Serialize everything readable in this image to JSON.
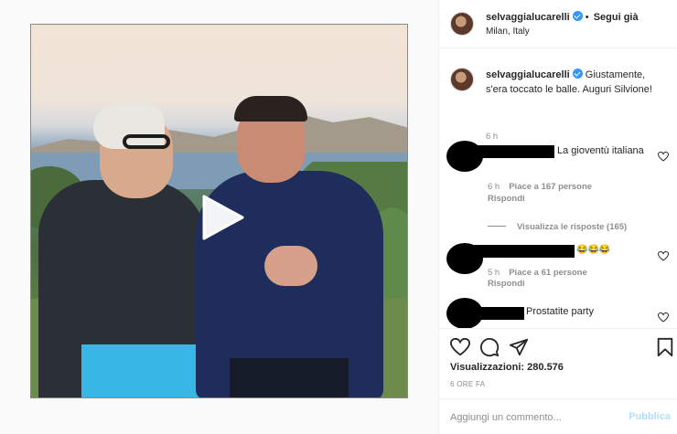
{
  "post": {
    "username": "selvaggialucarelli",
    "follow_separator": "•",
    "follow_label": "Segui già",
    "location": "Milan, Italy",
    "verified": true
  },
  "caption": {
    "username": "selvaggialucarelli",
    "text": "Giustamente, s'era toccato le balle. Auguri Silvione!",
    "time": "6 h"
  },
  "comments": [
    {
      "text": "La gioventù italiana",
      "time": "6 h",
      "likes": "Piace a 167 persone",
      "reply": "Rispondi",
      "view_replies": "Visualizza le risposte (165)"
    },
    {
      "text": "😂😂😂",
      "time": "5 h",
      "likes": "Piace a 61 persone",
      "reply": "Rispondi"
    },
    {
      "text": "Prostatite party"
    }
  ],
  "stats": {
    "views_label": "Visualizzazioni:",
    "views_value": "280.576",
    "posted_ago": "6 ORE FA"
  },
  "composer": {
    "placeholder": "Aggiungi un commento...",
    "publish_label": "Pubblica"
  },
  "colors": {
    "link_blue": "#3897f0",
    "publish_disabled": "#b2dffc",
    "meta_gray": "#8e8e8e"
  },
  "icons": [
    "play-icon",
    "verified-icon",
    "heart-icon",
    "comment-icon",
    "share-icon",
    "bookmark-icon"
  ]
}
